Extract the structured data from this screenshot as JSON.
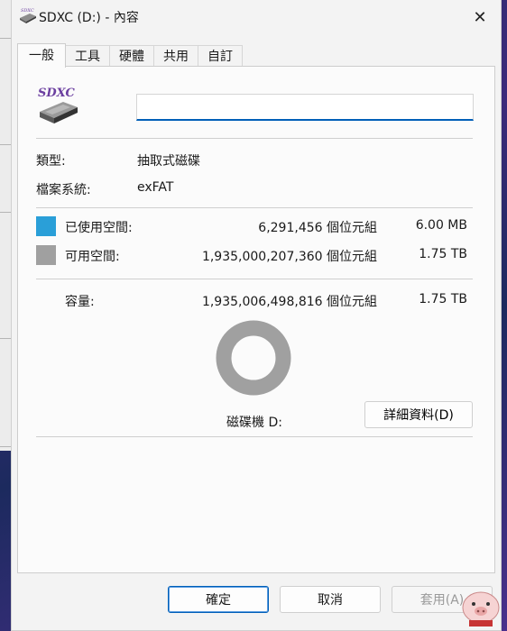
{
  "window": {
    "title": "SDXC (D:) - 內容"
  },
  "tabs": [
    {
      "label": "一般",
      "active": true
    },
    {
      "label": "工具",
      "active": false
    },
    {
      "label": "硬體",
      "active": false
    },
    {
      "label": "共用",
      "active": false
    },
    {
      "label": "自訂",
      "active": false
    }
  ],
  "drive": {
    "icon_text": "SDXC",
    "name_value": ""
  },
  "info": {
    "type_label": "類型:",
    "type_value": "抽取式磁碟",
    "fs_label": "檔案系統:",
    "fs_value": "exFAT"
  },
  "usage": {
    "used": {
      "label": "已使用空間:",
      "bytes": "6,291,456 個位元組",
      "size": "6.00 MB",
      "color": "#2a9fd8"
    },
    "free": {
      "label": "可用空間:",
      "bytes": "1,935,000,207,360 個位元組",
      "size": "1.75 TB",
      "color": "#a0a0a0"
    },
    "capacity": {
      "label": "容量:",
      "bytes": "1,935,006,498,816 個位元組",
      "size": "1.75 TB"
    },
    "used_fraction": 3.3e-06
  },
  "drive_label": "磁碟機 D:",
  "buttons": {
    "details": "詳細資料(D)",
    "ok": "確定",
    "cancel": "取消",
    "apply": "套用(A)"
  }
}
